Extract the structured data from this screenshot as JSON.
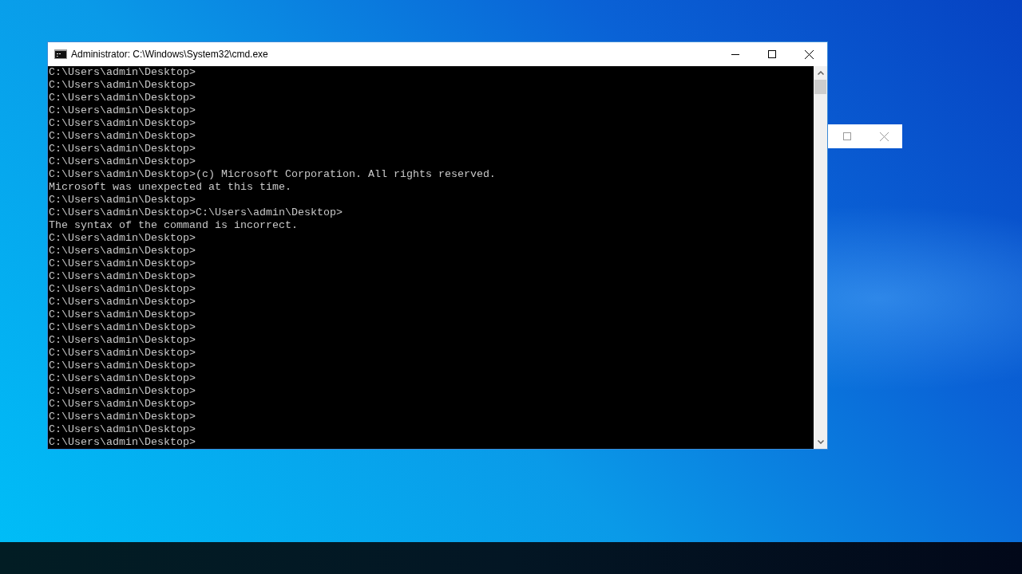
{
  "desktop": {
    "windows": [
      {
        "kind": "console",
        "active": true,
        "title": "Administrator: C:\\Windows\\System32\\cmd.exe",
        "lines": [
          "C:\\Users\\admin\\Desktop>",
          "C:\\Users\\admin\\Desktop>",
          "C:\\Users\\admin\\Desktop>",
          "C:\\Users\\admin\\Desktop>",
          "C:\\Users\\admin\\Desktop>",
          "C:\\Users\\admin\\Desktop>",
          "C:\\Users\\admin\\Desktop>",
          "C:\\Users\\admin\\Desktop>",
          "C:\\Users\\admin\\Desktop>(c) Microsoft Corporation. All rights reserved.",
          "Microsoft was unexpected at this time.",
          "C:\\Users\\admin\\Desktop>",
          "C:\\Users\\admin\\Desktop>C:\\Users\\admin\\Desktop>",
          "The syntax of the command is incorrect.",
          "C:\\Users\\admin\\Desktop>",
          "C:\\Users\\admin\\Desktop>",
          "C:\\Users\\admin\\Desktop>",
          "C:\\Users\\admin\\Desktop>",
          "C:\\Users\\admin\\Desktop>",
          "C:\\Users\\admin\\Desktop>",
          "C:\\Users\\admin\\Desktop>",
          "C:\\Users\\admin\\Desktop>",
          "C:\\Users\\admin\\Desktop>",
          "C:\\Users\\admin\\Desktop>",
          "C:\\Users\\admin\\Desktop>",
          "C:\\Users\\admin\\Desktop>",
          "C:\\Users\\admin\\Desktop>",
          "C:\\Users\\admin\\Desktop>",
          "C:\\Users\\admin\\Desktop>",
          "C:\\Users\\admin\\Desktop>",
          "C:\\Users\\admin\\Desktop>"
        ]
      },
      {
        "kind": "frame",
        "active": false
      }
    ]
  }
}
